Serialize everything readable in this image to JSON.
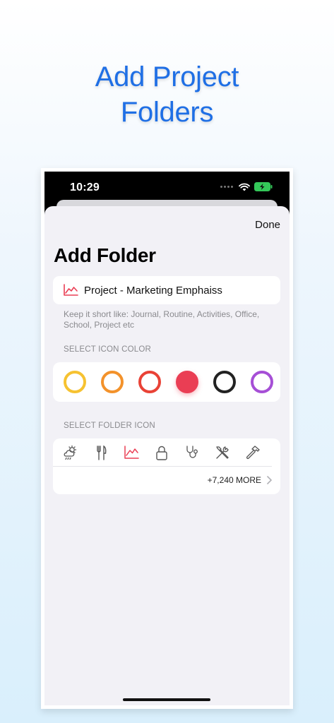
{
  "headline": {
    "line1": "Add Project",
    "line2": "Folders"
  },
  "status_bar": {
    "time": "10:29"
  },
  "sheet": {
    "done_label": "Done",
    "title": "Add Folder",
    "name_field": {
      "value": "Project - Marketing Emphaiss",
      "icon": "chart-line-icon"
    },
    "hint": "Keep it short like: Journal, Routine, Activities, Office, School, Project etc",
    "color_section_label": "SELECT ICON COLOR",
    "colors": [
      {
        "name": "yellow",
        "hex": "#f6c231",
        "selected": false
      },
      {
        "name": "orange",
        "hex": "#f3922b",
        "selected": false
      },
      {
        "name": "red",
        "hex": "#e94236",
        "selected": false
      },
      {
        "name": "pink-red",
        "hex": "#ea3e54",
        "selected": true
      },
      {
        "name": "black",
        "hex": "#222222",
        "selected": false
      },
      {
        "name": "purple",
        "hex": "#a64fd6",
        "selected": false
      }
    ],
    "icon_section_label": "SELECT FOLDER ICON",
    "icons": [
      "weather-icon",
      "fork-knife-icon",
      "chart-line-icon",
      "lock-icon",
      "stethoscope-icon",
      "tools-icon",
      "hammer-icon"
    ],
    "more_label": "+7,240 MORE"
  },
  "accent_color": "#ea3e54",
  "headline_color": "#1f6fe5"
}
